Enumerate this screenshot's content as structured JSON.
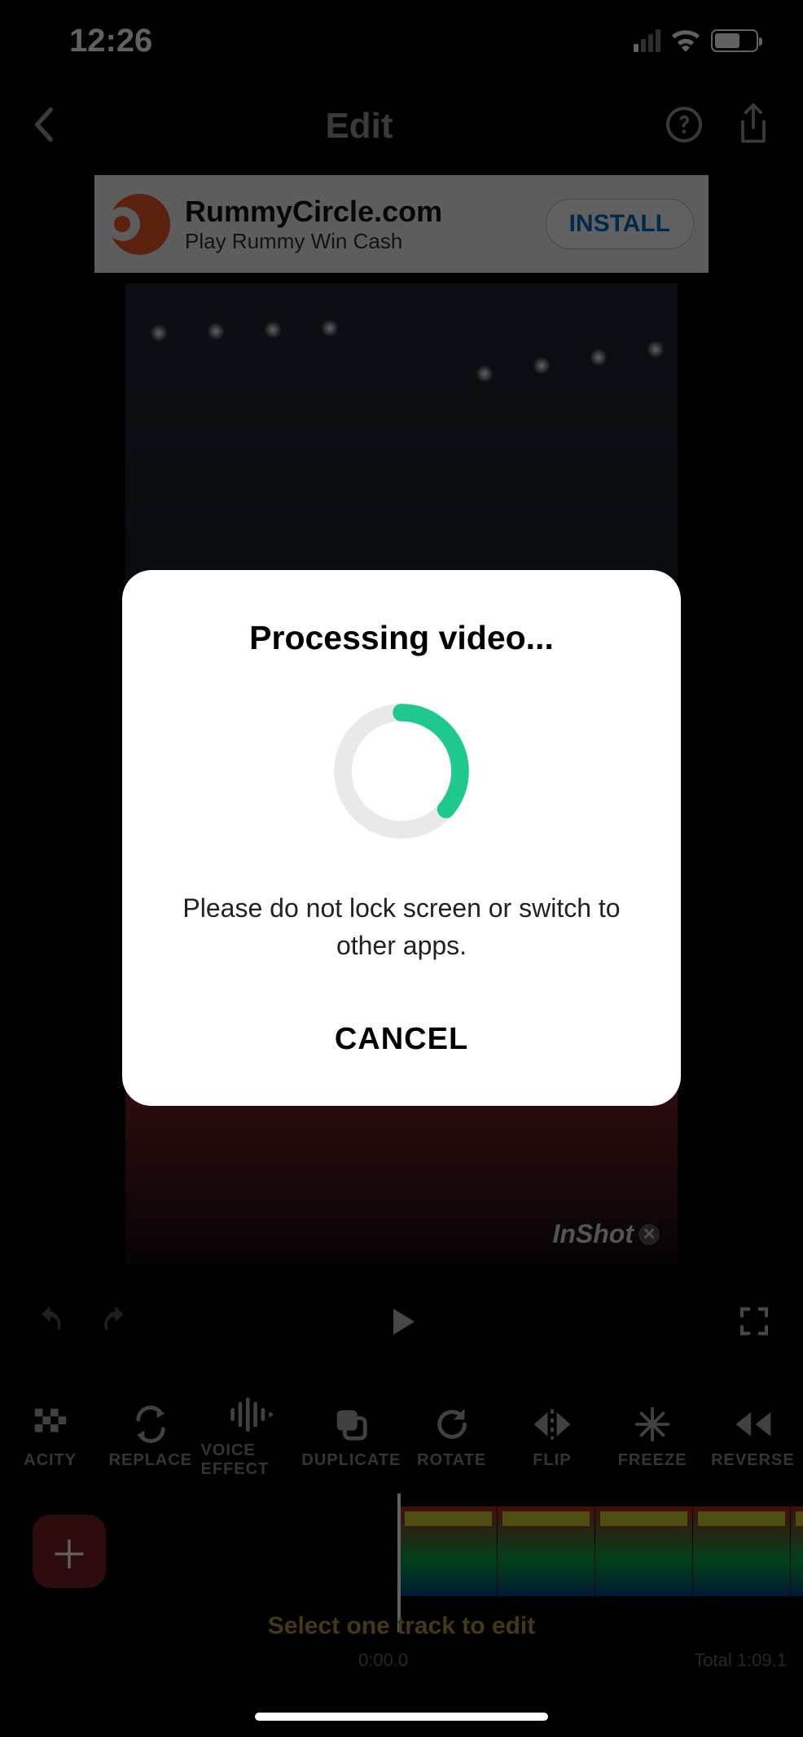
{
  "status": {
    "time": "12:26"
  },
  "nav": {
    "title": "Edit"
  },
  "ad": {
    "title": "RummyCircle.com",
    "subtitle": "Play Rummy Win Cash",
    "cta": "INSTALL"
  },
  "watermark": {
    "text": "InShot"
  },
  "tools": [
    {
      "key": "opacity",
      "label": "ACITY"
    },
    {
      "key": "replace",
      "label": "REPLACE"
    },
    {
      "key": "voiceeffect",
      "label": "VOICE EFFECT"
    },
    {
      "key": "duplicate",
      "label": "DUPLICATE"
    },
    {
      "key": "rotate",
      "label": "ROTATE"
    },
    {
      "key": "flip",
      "label": "FLIP"
    },
    {
      "key": "freeze",
      "label": "FREEZE"
    },
    {
      "key": "reverse",
      "label": "REVERSE"
    }
  ],
  "timeline": {
    "hint": "Select one track to edit",
    "current": "0:00.0",
    "total": "Total 1:09.1"
  },
  "modal": {
    "title": "Processing video...",
    "message": "Please do not lock screen or switch to other apps.",
    "cancel": "CANCEL"
  }
}
